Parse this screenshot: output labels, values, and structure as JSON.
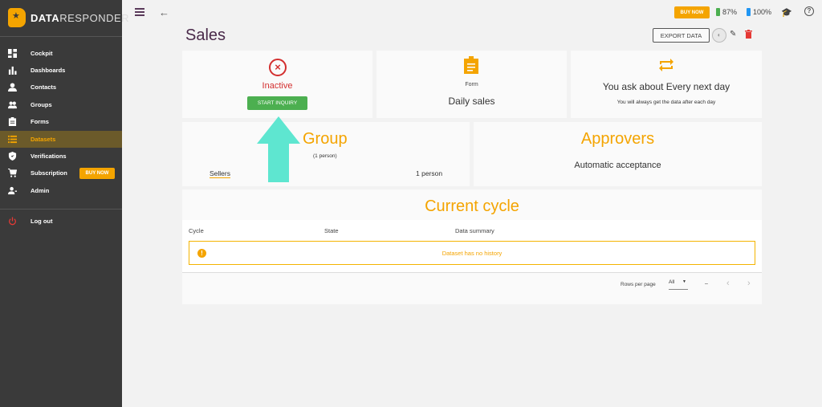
{
  "app": {
    "logo_bold": "DATA",
    "logo_light": "RESPONDER"
  },
  "sidebar": {
    "items": [
      {
        "label": "Cockpit",
        "icon": "grid-icon"
      },
      {
        "label": "Dashboards",
        "icon": "bar-chart-icon"
      },
      {
        "label": "Contacts",
        "icon": "person-icon"
      },
      {
        "label": "Groups",
        "icon": "group-icon"
      },
      {
        "label": "Forms",
        "icon": "clipboard-icon"
      },
      {
        "label": "Datasets",
        "icon": "list-icon",
        "active": true
      },
      {
        "label": "Verifications",
        "icon": "shield-check-icon"
      },
      {
        "label": "Subscription",
        "icon": "cart-icon"
      },
      {
        "label": "Admin",
        "icon": "admin-icon"
      }
    ],
    "buy_now": "BUY NOW",
    "logout": "Log out"
  },
  "topbar": {
    "buy_now": "BUY NOW",
    "battery_green": "87%",
    "battery_blue": "100%",
    "colors": {
      "green": "#4caf50",
      "blue": "#2196f3"
    }
  },
  "page": {
    "title": "Sales",
    "export": "EXPORT DATA"
  },
  "status_card": {
    "status": "Inactive",
    "action": "START INQUIRY"
  },
  "form_card": {
    "label": "Form",
    "value": "Daily sales"
  },
  "schedule_card": {
    "title": "You ask about Every next day",
    "subtitle": "You will always get the data after each day"
  },
  "group_card": {
    "title": "Group",
    "count": "(1 person)",
    "name": "Sellers",
    "persons": "1 person"
  },
  "approvers_card": {
    "title": "Approvers",
    "value": "Automatic acceptance"
  },
  "cycle": {
    "title": "Current cycle",
    "columns": [
      "Cycle",
      "State",
      "Data summary"
    ],
    "empty": "Dataset has no history",
    "rows_per_page_label": "Rows per page",
    "rows_per_page_value": "All",
    "range": "–"
  },
  "colors": {
    "accent": "#f4a400",
    "danger": "#d32f2f",
    "success": "#4caf50",
    "highlight_arrow": "#5ee6d0"
  }
}
